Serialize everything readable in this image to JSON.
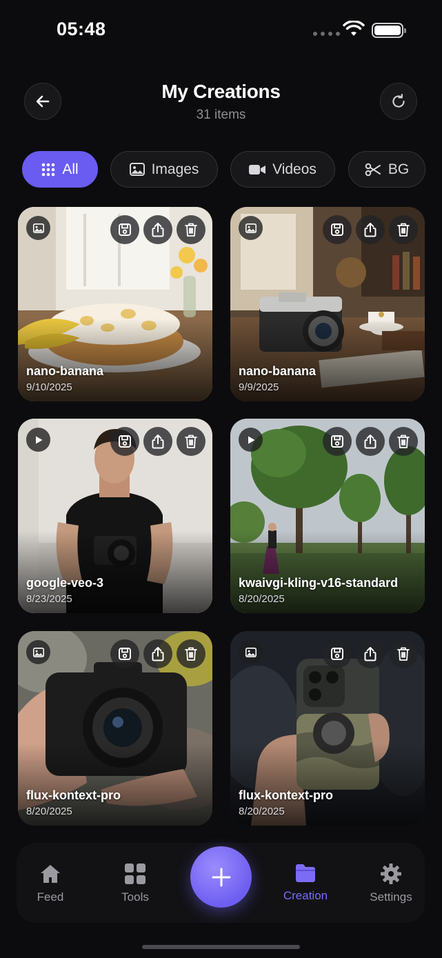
{
  "status_bar": {
    "time": "05:48"
  },
  "header": {
    "title": "My Creations",
    "subtitle": "31 items"
  },
  "tabs": [
    {
      "label": "All",
      "icon": "grid-icon",
      "active": true
    },
    {
      "label": "Images",
      "icon": "image-icon",
      "active": false
    },
    {
      "label": "Videos",
      "icon": "video-icon",
      "active": false
    },
    {
      "label": "BG",
      "icon": "scissors-icon",
      "active": false
    }
  ],
  "creations": [
    {
      "type": "image",
      "model": "nano-banana",
      "date": "9/10/2025"
    },
    {
      "type": "image",
      "model": "nano-banana",
      "date": "9/9/2025"
    },
    {
      "type": "video",
      "model": "google-veo-3",
      "date": "8/23/2025"
    },
    {
      "type": "video",
      "model": "kwaivgi-kling-v16-standard",
      "date": "8/20/2025"
    },
    {
      "type": "image",
      "model": "flux-kontext-pro",
      "date": "8/20/2025"
    },
    {
      "type": "image",
      "model": "flux-kontext-pro",
      "date": "8/20/2025"
    }
  ],
  "nav": {
    "items": [
      {
        "label": "Feed",
        "icon": "home-icon",
        "active": false
      },
      {
        "label": "Tools",
        "icon": "grid-tiles-icon",
        "active": false
      },
      {
        "label": "Creation",
        "icon": "folder-icon",
        "active": true
      },
      {
        "label": "Settings",
        "icon": "gear-icon",
        "active": false
      }
    ],
    "fab_icon": "plus-icon"
  },
  "colors": {
    "accent": "#6a5cf0",
    "background": "#0c0c0e",
    "active_nav": "#7c6cf5"
  }
}
